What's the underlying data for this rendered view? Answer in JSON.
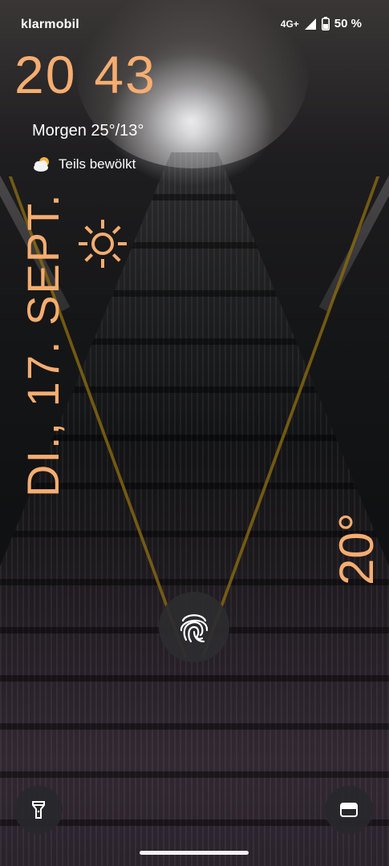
{
  "status_bar": {
    "carrier": "klarmobil",
    "network": "4G+",
    "battery_percent": "50 %"
  },
  "clock": {
    "hours": "20",
    "minutes": "43"
  },
  "weather": {
    "tomorrow": "Morgen 25°/13°",
    "condition": "Teils bewölkt",
    "current_temp": "20°"
  },
  "date": "DI., 17. SEPT.",
  "icons": {
    "signal": "cell-signal-icon",
    "battery": "battery-icon",
    "weather_small": "partly-cloudy-icon",
    "weather_large": "sun-icon",
    "fingerprint": "fingerprint-icon",
    "flashlight": "flashlight-icon",
    "wallet": "wallet-icon"
  },
  "colors": {
    "accent": "#f6ad70",
    "text": "#ffffff"
  }
}
